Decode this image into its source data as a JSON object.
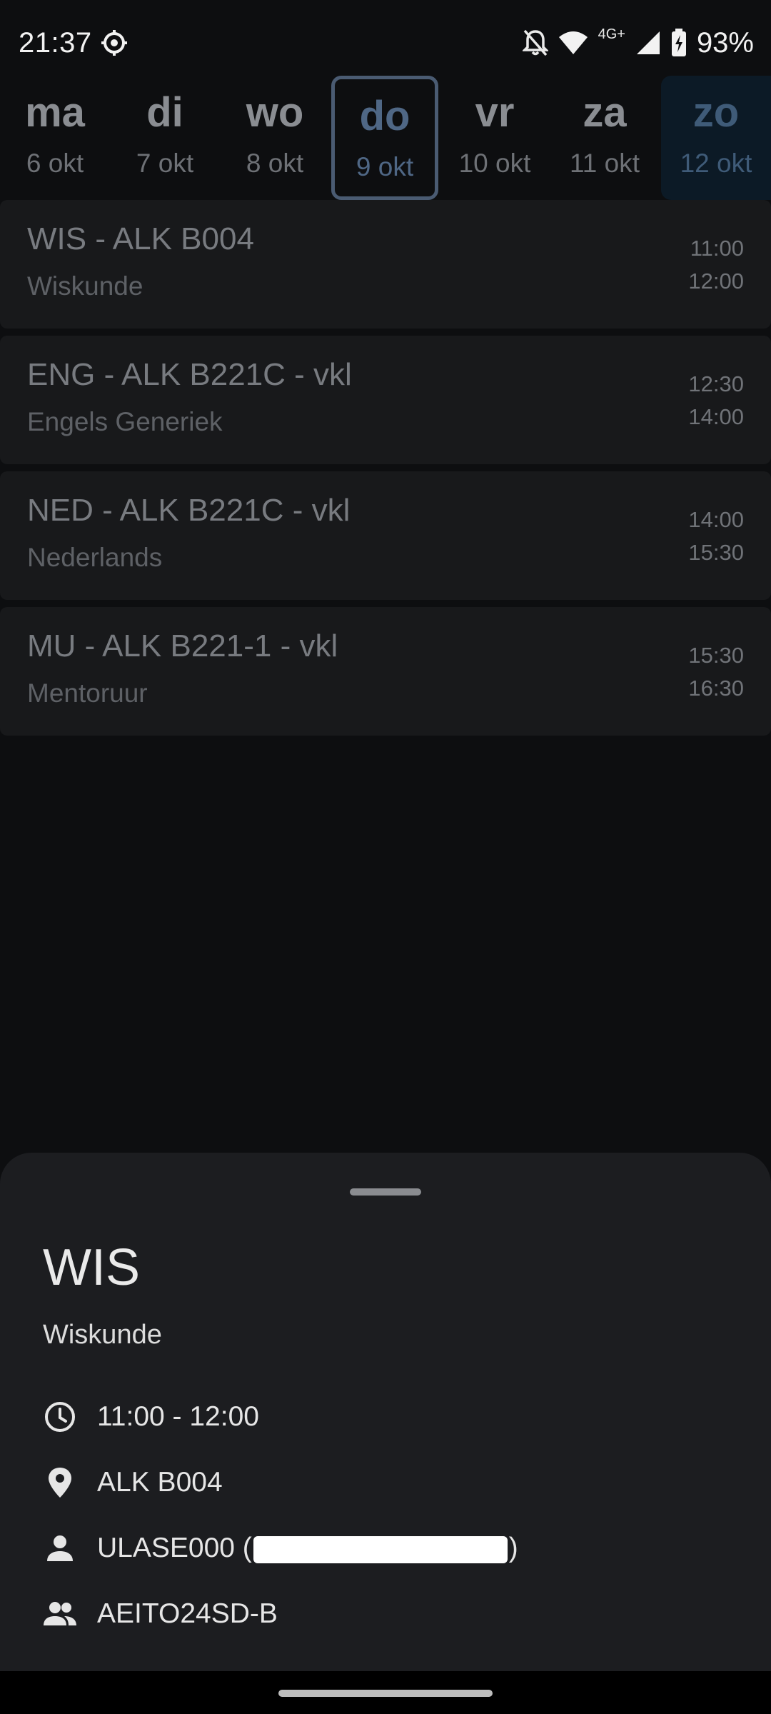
{
  "status_bar": {
    "time": "21:37",
    "network": "4G+",
    "battery": "93%",
    "icons": [
      "settings-gear-icon",
      "mute-bell-icon",
      "wifi-icon",
      "cell-signal-icon",
      "battery-charging-icon"
    ]
  },
  "days": [
    {
      "abbr": "ma",
      "date": "6 okt"
    },
    {
      "abbr": "di",
      "date": "7 okt"
    },
    {
      "abbr": "wo",
      "date": "8 okt"
    },
    {
      "abbr": "do",
      "date": "9 okt",
      "selected": true
    },
    {
      "abbr": "vr",
      "date": "10 okt"
    },
    {
      "abbr": "za",
      "date": "11 okt"
    },
    {
      "abbr": "zo",
      "date": "12 okt"
    }
  ],
  "lessons": [
    {
      "title": "WIS - ALK B004",
      "subject": "Wiskunde",
      "start": "11:00",
      "end": "12:00"
    },
    {
      "title": "ENG - ALK B221C - vkl",
      "subject": "Engels Generiek",
      "start": "12:30",
      "end": "14:00"
    },
    {
      "title": "NED - ALK B221C - vkl",
      "subject": "Nederlands",
      "start": "14:00",
      "end": "15:30"
    },
    {
      "title": "MU - ALK B221-1 - vkl",
      "subject": "Mentoruur",
      "start": "15:30",
      "end": "16:30"
    }
  ],
  "detail": {
    "title": "WIS",
    "subject": "Wiskunde",
    "time": "11:00 - 12:00",
    "location": "ALK B004",
    "teacher_prefix": "ULASE000 (",
    "teacher_suffix": ")",
    "group": "AEITO24SD-B"
  },
  "colors": {
    "background": "#0d0e10",
    "card": "#18191b",
    "sheet": "#1c1d20",
    "selected_border": "#4a5b72",
    "weekend_bg": "#0c1a26"
  }
}
